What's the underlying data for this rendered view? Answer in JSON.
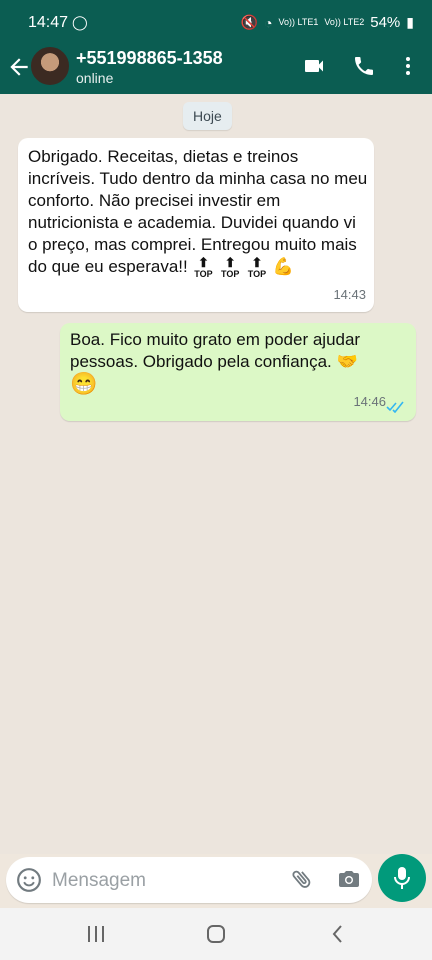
{
  "status_bar": {
    "time": "14:47",
    "battery": "54%",
    "signal_labels": [
      "Vo)) LTE1",
      "Vo)) LTE2"
    ]
  },
  "header": {
    "contact_name": "+551998865-1358",
    "contact_status": "online",
    "icons": [
      "back-arrow-icon",
      "video-call-icon",
      "phone-icon",
      "more-options-icon"
    ],
    "color": "#0b5d52"
  },
  "chat": {
    "date_chip": "Hoje",
    "messages": [
      {
        "direction": "incoming",
        "text": "Obrigado. Receitas, dietas e treinos incríveis. Tudo dentro da minha casa no meu conforto. Não precisei investir em nutricionista e academia. Duvidei quando vi o preço, mas comprei. Entregou muito mais do que eu esperava!!",
        "emojis": [
          "🔝",
          "🔝",
          "🔝",
          "💪🏻"
        ],
        "time": "14:43"
      },
      {
        "direction": "outgoing",
        "text": "Boa. Fico muito grato em poder ajudar pessoas. Obrigado pela confiança.",
        "emojis": [
          "🤝🏻",
          "😁"
        ],
        "time": "14:46",
        "status": "read"
      }
    ]
  },
  "input": {
    "placeholder": "Mensagem"
  },
  "colors": {
    "outgoing_bubble": "#dcf8c6",
    "incoming_bubble": "#ffffff",
    "mic_button": "#019a7b",
    "read_ticks": "#34b7f1"
  }
}
